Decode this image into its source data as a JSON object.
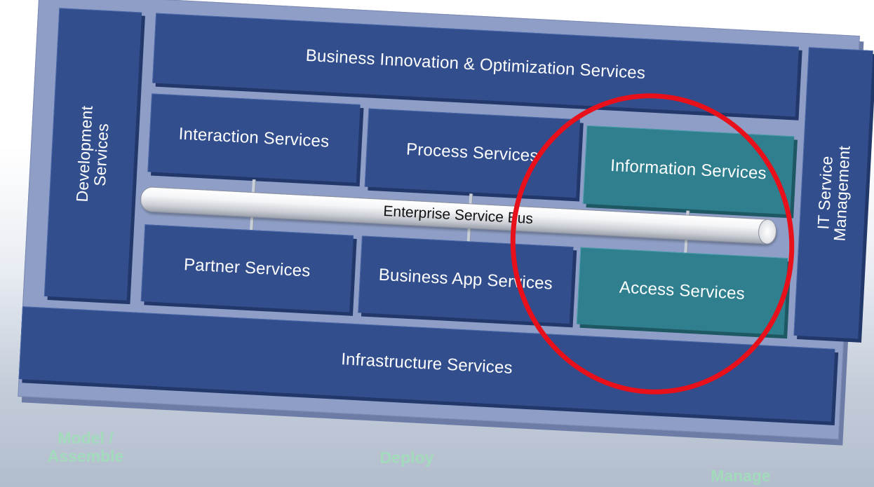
{
  "diagram": {
    "blocks": {
      "development": "Development Services",
      "development_line1": "Development",
      "development_line2": "Services",
      "innovation": "Business Innovation & Optimization Services",
      "interaction": "Interaction Services",
      "process": "Process Services",
      "information": "Information Services",
      "bus": "Enterprise Service Bus",
      "partner": "Partner Services",
      "business_app": "Business App Services",
      "access": "Access Services",
      "infrastructure": "Infrastructure Services",
      "it_service_line1": "IT Service",
      "it_service_line2": "Management"
    },
    "lifecycle": {
      "model_line1": "Model /",
      "model_line2": "Assemble",
      "deploy": "Deploy",
      "manage": "Manage"
    },
    "colors": {
      "block": "#324e8c",
      "highlight_block": "#2f7f8e",
      "highlight_ring": "#e8101a",
      "plate": "#8e9ec6",
      "lifecycle_text": "#9fe0b8"
    }
  }
}
